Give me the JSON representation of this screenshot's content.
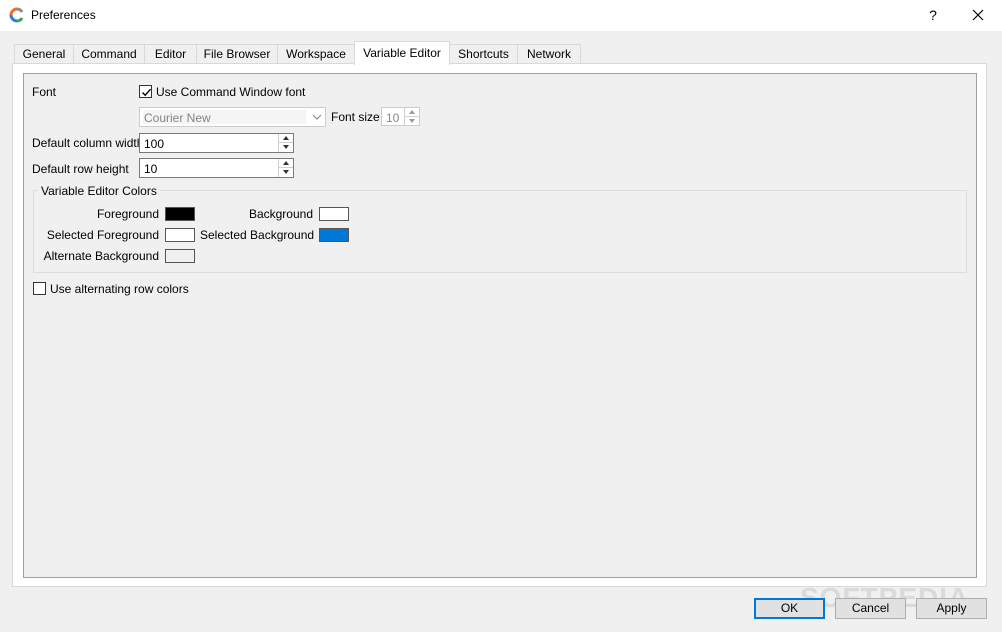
{
  "window": {
    "title": "Preferences",
    "help_label": "?",
    "close_label": "✕"
  },
  "tabs": [
    {
      "label": "General"
    },
    {
      "label": "Command"
    },
    {
      "label": "Editor"
    },
    {
      "label": "File Browser"
    },
    {
      "label": "Workspace"
    },
    {
      "label": "Variable Editor"
    },
    {
      "label": "Shortcuts"
    },
    {
      "label": "Network"
    }
  ],
  "active_tab": "Variable Editor",
  "variable_editor": {
    "font_label": "Font",
    "use_command_window_font_label": "Use Command Window font",
    "use_command_window_font_checked": true,
    "font_family_value": "Courier New",
    "font_size_label": "Font size",
    "font_size_value": "10",
    "default_column_width_label": "Default column width",
    "default_column_width_value": "100",
    "default_row_height_label": "Default row height",
    "default_row_height_value": "10",
    "colors_group_title": "Variable Editor Colors",
    "colors": {
      "foreground_label": "Foreground",
      "foreground_color": "#000000",
      "background_label": "Background",
      "background_color": "#ffffff",
      "selected_foreground_label": "Selected Foreground",
      "selected_foreground_color": "#ffffff",
      "selected_background_label": "Selected Background",
      "selected_background_color": "#0078d7",
      "alternate_background_label": "Alternate Background",
      "alternate_background_color": "#f0f0f0"
    },
    "use_alternating_row_colors_label": "Use alternating row colors",
    "use_alternating_row_colors_checked": false
  },
  "buttons": {
    "ok": "OK",
    "cancel": "Cancel",
    "apply": "Apply"
  },
  "watermark": "SOFTPEDIA"
}
